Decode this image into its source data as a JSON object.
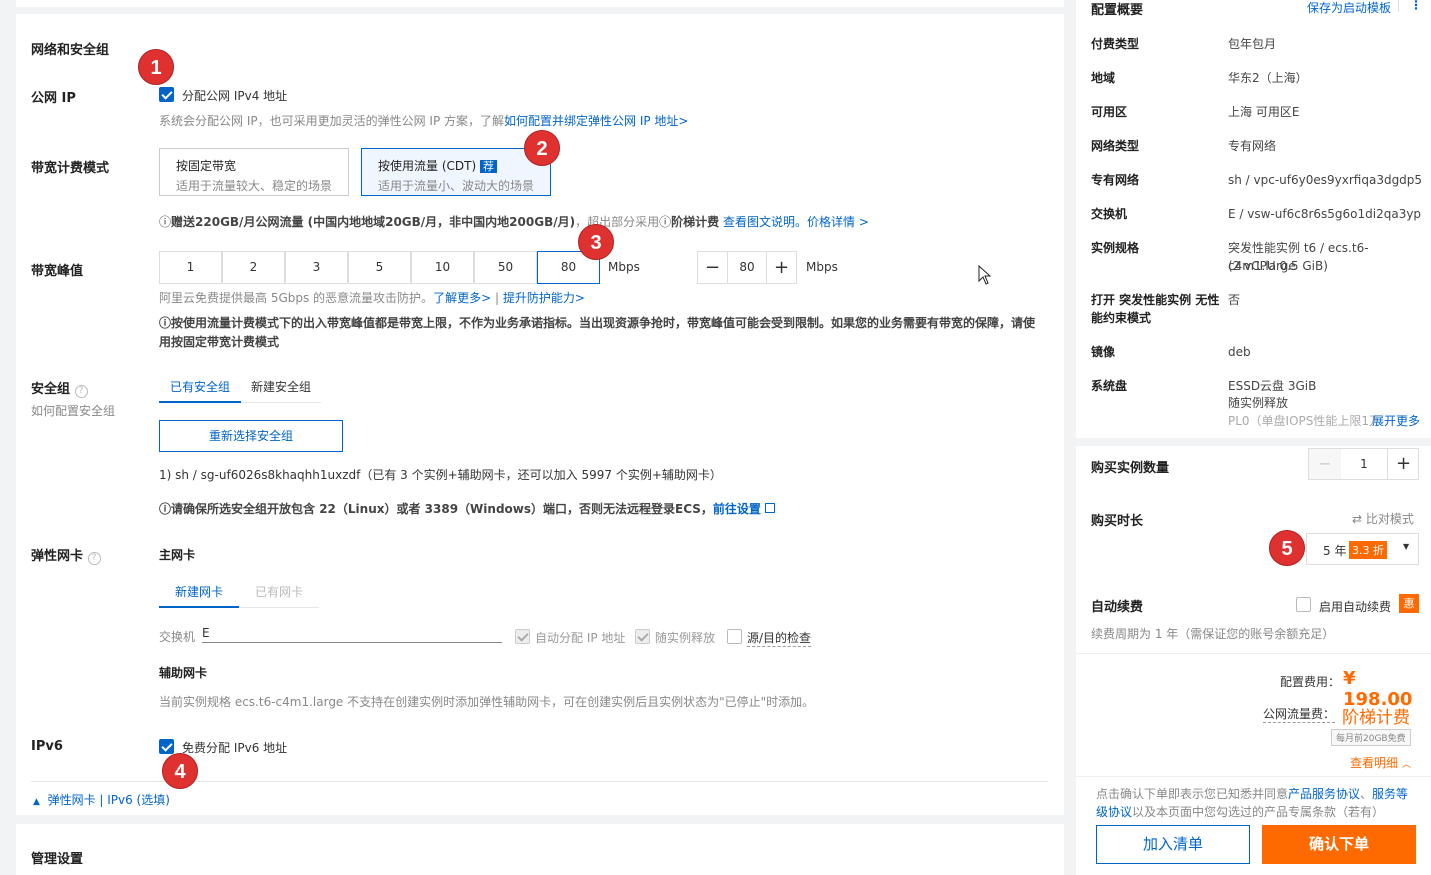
{
  "network": {
    "section_title": "网络和安全组",
    "public_ip_label": "公网 IP",
    "public_ip_checkbox": "分配公网 IPv4 地址",
    "public_ip_hint": "系统会分配公网 IP，也可采用更加灵活的弹性公网 IP 方案，了解",
    "public_ip_link": "如何配置并绑定弹性公网 IP 地址>",
    "billing_label": "带宽计费模式",
    "billing_fixed_title": "按固定带宽",
    "billing_fixed_desc": "适用于流量较大、稳定的场景",
    "billing_traffic_title": "按使用流量 (CDT)",
    "billing_traffic_badge": "荐",
    "billing_traffic_desc": "适用于流量小、波动大的场景",
    "billing_note_bold": "赠送220GB/月公网流量 (中国内地地域20GB/月，非中国内地200GB/月)",
    "billing_note_rest": "，超出部分采用",
    "billing_note_tier": "阶梯计费",
    "billing_note_link1": "查看图文说明",
    "billing_note_sep": "。",
    "billing_note_link2": "价格详情 >",
    "peak_label": "带宽峰值",
    "peak_options": [
      "1",
      "2",
      "3",
      "5",
      "10",
      "50",
      "80"
    ],
    "peak_unit": "Mbps",
    "peak_value": "80",
    "peak_unit2": "Mbps",
    "peak_hint": "阿里云免费提供最高 5Gbps 的恶意流量攻击防护。",
    "peak_link1": "了解更多>",
    "peak_sep": "|",
    "peak_link2": "提升防护能力>",
    "peak_note": "按使用流量计费模式下的出入带宽峰值都是带宽上限，不作为业务承诺指标。当出现资源争抢时，带宽峰值可能会受到限制。如果您的业务需要有带宽的保障，请使用按固定带宽计费模式",
    "sg_label": "安全组",
    "sg_help": "如何配置安全组",
    "sg_tab_existing": "已有安全组",
    "sg_tab_new": "新建安全组",
    "sg_reselect": "重新选择安全组",
    "sg_selected": "1) sh / sg-uf6026s8khaqhh1uxzdf（已有 3 个实例+辅助网卡，还可以加入 5997 个实例+辅助网卡）",
    "sg_warning": "请确保所选安全组开放包含 22（Linux）或者 3389（Windows）端口，否则无法远程登录ECS，",
    "sg_warning_link": "前往设置",
    "eni_label": "弹性网卡",
    "eni_primary": "主网卡",
    "eni_tab_new": "新建网卡",
    "eni_tab_existing": "已有网卡",
    "eni_switch_label": "交换机",
    "eni_switch_value": "E",
    "eni_auto_ip": "自动分配 IP 地址",
    "eni_release": "随实例释放",
    "eni_src_check": "源/目的检查",
    "eni_aux_title": "辅助网卡",
    "eni_aux_note": "当前实例规格 ecs.t6-c4m1.large 不支持在创建实例时添加弹性辅助网卡，可在创建实例后且实例状态为\"已停止\"时添加。",
    "ipv6_label": "IPv6",
    "ipv6_checkbox": "免费分配 IPv6 地址",
    "collapse_link": "弹性网卡 | IPv6 (选填)"
  },
  "mgmt": {
    "section_title": "管理设置"
  },
  "summary": {
    "title": "配置概要",
    "save_template": "保存为启动模板",
    "rows": [
      {
        "k": "付费类型",
        "v": "包年包月"
      },
      {
        "k": "地域",
        "v": "华东2（上海）"
      },
      {
        "k": "可用区",
        "v": "上海 可用区E"
      },
      {
        "k": "网络类型",
        "v": "专有网络"
      },
      {
        "k": "专有网络",
        "v": "sh / vpc-uf6y0es9yxrfiqa3dgdp5"
      },
      {
        "k": "交换机",
        "v": "E / vsw-uf6c8r6s5g6o1di2qa3yp"
      },
      {
        "k": "实例规格",
        "v": "突发性能实例 t6 / ecs.t6-c4m1.large",
        "v2": "(2 vCPU 0.5 GiB)"
      },
      {
        "k": "打开 突发性能实例 无性",
        "k2": "能约束模式",
        "v": "否"
      },
      {
        "k": "镜像",
        "v": "deb"
      },
      {
        "k": "系统盘",
        "v": "ESSD云盘 3GiB",
        "v2": "随实例释放",
        "v3": "PL0（单盘IOPS性能上限1万）"
      }
    ],
    "show_more": "展开更多"
  },
  "purchase": {
    "qty_label": "购买实例数量",
    "qty_value": "1",
    "duration_label": "购买时长",
    "compare_mode": "比对模式",
    "duration_value": "5 年",
    "duration_discount": "3.3 折",
    "auto_renew_label": "自动续费",
    "auto_renew_checkbox": "启用自动续费",
    "auto_renew_badge": "惠",
    "renew_note": "续费周期为 1 年（需保证您的账号余额充足）",
    "fee_label": "配置费用：",
    "fee_value": "¥ 198.00",
    "traffic_label": "公网流量费：",
    "traffic_value": "阶梯计费",
    "traffic_tag": "每月前20GB免费",
    "details_link": "查看明细",
    "agree_pre": "点击确认下单即表示您已知悉并同意",
    "agree_link1": "产品服务协议",
    "agree_sep": "、",
    "agree_link2": "服务等级协议",
    "agree_post": "以及本页面中您勾选过的产品专属条款（若有）",
    "add_cart": "加入清单",
    "confirm": "确认下单"
  },
  "markers": [
    "1",
    "2",
    "3",
    "4",
    "5"
  ]
}
